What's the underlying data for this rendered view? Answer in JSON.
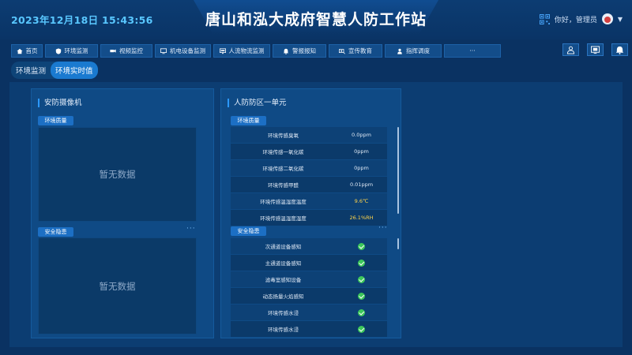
{
  "header": {
    "datetime": "2023年12月18日 15:43:56",
    "title": "唐山和泓大成府智慧人防工作站",
    "greeting": "你好，管理员"
  },
  "nav": {
    "items": [
      {
        "label": "首页",
        "icon": "home-icon"
      },
      {
        "label": "环境监测",
        "icon": "shield-icon"
      },
      {
        "label": "视频监控",
        "icon": "camera-icon"
      },
      {
        "label": "机电设备监测",
        "icon": "monitor-icon"
      },
      {
        "label": "人流物流监测",
        "icon": "display-icon"
      },
      {
        "label": "警报报知",
        "icon": "bell-icon"
      },
      {
        "label": "宣传教育",
        "icon": "projector-icon"
      },
      {
        "label": "指挥调度",
        "icon": "person-icon"
      },
      {
        "label": "···",
        "icon": ""
      }
    ],
    "right_icons": [
      "user-icon",
      "screen-icon",
      "bell-icon"
    ]
  },
  "tabs": [
    {
      "label": "环境监测",
      "active": false
    },
    {
      "label": "环境实时值",
      "active": true
    }
  ],
  "left_panel": {
    "title": "安防摄像机",
    "section1_tag": "环境质量",
    "section1_empty": "暂无数据",
    "section2_tag": "安全隐患",
    "section2_more": "···",
    "section2_empty": "暂无数据"
  },
  "right_panel": {
    "title": "人防防区一单元",
    "env_tag": "环境质量",
    "env_rows": [
      {
        "name": "环境传感臭氧",
        "value": "0.0ppm",
        "highlight": false
      },
      {
        "name": "环境传感一氧化碳",
        "value": "0ppm",
        "highlight": false
      },
      {
        "name": "环境传感二氧化碳",
        "value": "0ppm",
        "highlight": false
      },
      {
        "name": "环境传感甲醛",
        "value": "0.01ppm",
        "highlight": false
      },
      {
        "name": "环境传感温湿度温度",
        "value": "9.6℃",
        "highlight": true
      },
      {
        "name": "环境传感温湿度湿度",
        "value": "26.1%RH",
        "highlight": true
      }
    ],
    "safety_tag": "安全隐患",
    "safety_more": "···",
    "safety_rows": [
      {
        "name": "次通道设备感知",
        "status": "ok"
      },
      {
        "name": "主通道设备感知",
        "status": "ok"
      },
      {
        "name": "滤毒室感知设备",
        "status": "ok"
      },
      {
        "name": "动态扬量火焰感知",
        "status": "ok"
      },
      {
        "name": "环境传感水浸",
        "status": "ok"
      },
      {
        "name": "环境传感水浸",
        "status": "ok"
      }
    ]
  },
  "colors": {
    "background": "#0a3262",
    "accent": "#1a7ad0",
    "datetime": "#59c7ff",
    "ok": "#3cc75a",
    "highlight_value": "#ffd44a"
  }
}
